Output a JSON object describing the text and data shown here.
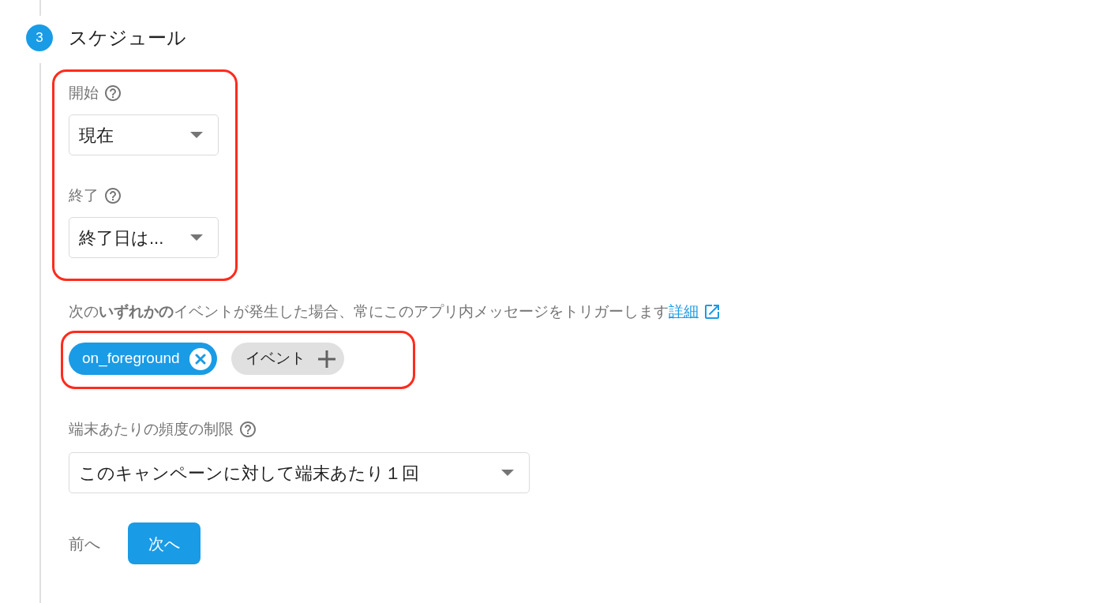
{
  "step": {
    "number": "3",
    "title": "スケジュール"
  },
  "schedule": {
    "highlighted": true,
    "fields": [
      {
        "label": "開始",
        "value": "現在"
      },
      {
        "label": "終了",
        "value": "終了日は..."
      }
    ]
  },
  "trigger_note": {
    "text": "次の**いずれかの**イベントが発生した場合、常にこのアプリ内メッセージをトリガーします",
    "link": "詳細"
  },
  "events": {
    "highlighted": true,
    "chips": [
      {
        "kind": "event",
        "label": "on_foreground"
      },
      {
        "kind": "add",
        "label": "イベント"
      }
    ]
  },
  "frequency": {
    "label": "端末あたりの頻度の制限",
    "value": "このキャンペーンに対して端末あたり１回"
  },
  "buttons": [
    {
      "kind": "text",
      "label": "前へ"
    },
    {
      "kind": "primary",
      "label": "次へ"
    }
  ]
}
